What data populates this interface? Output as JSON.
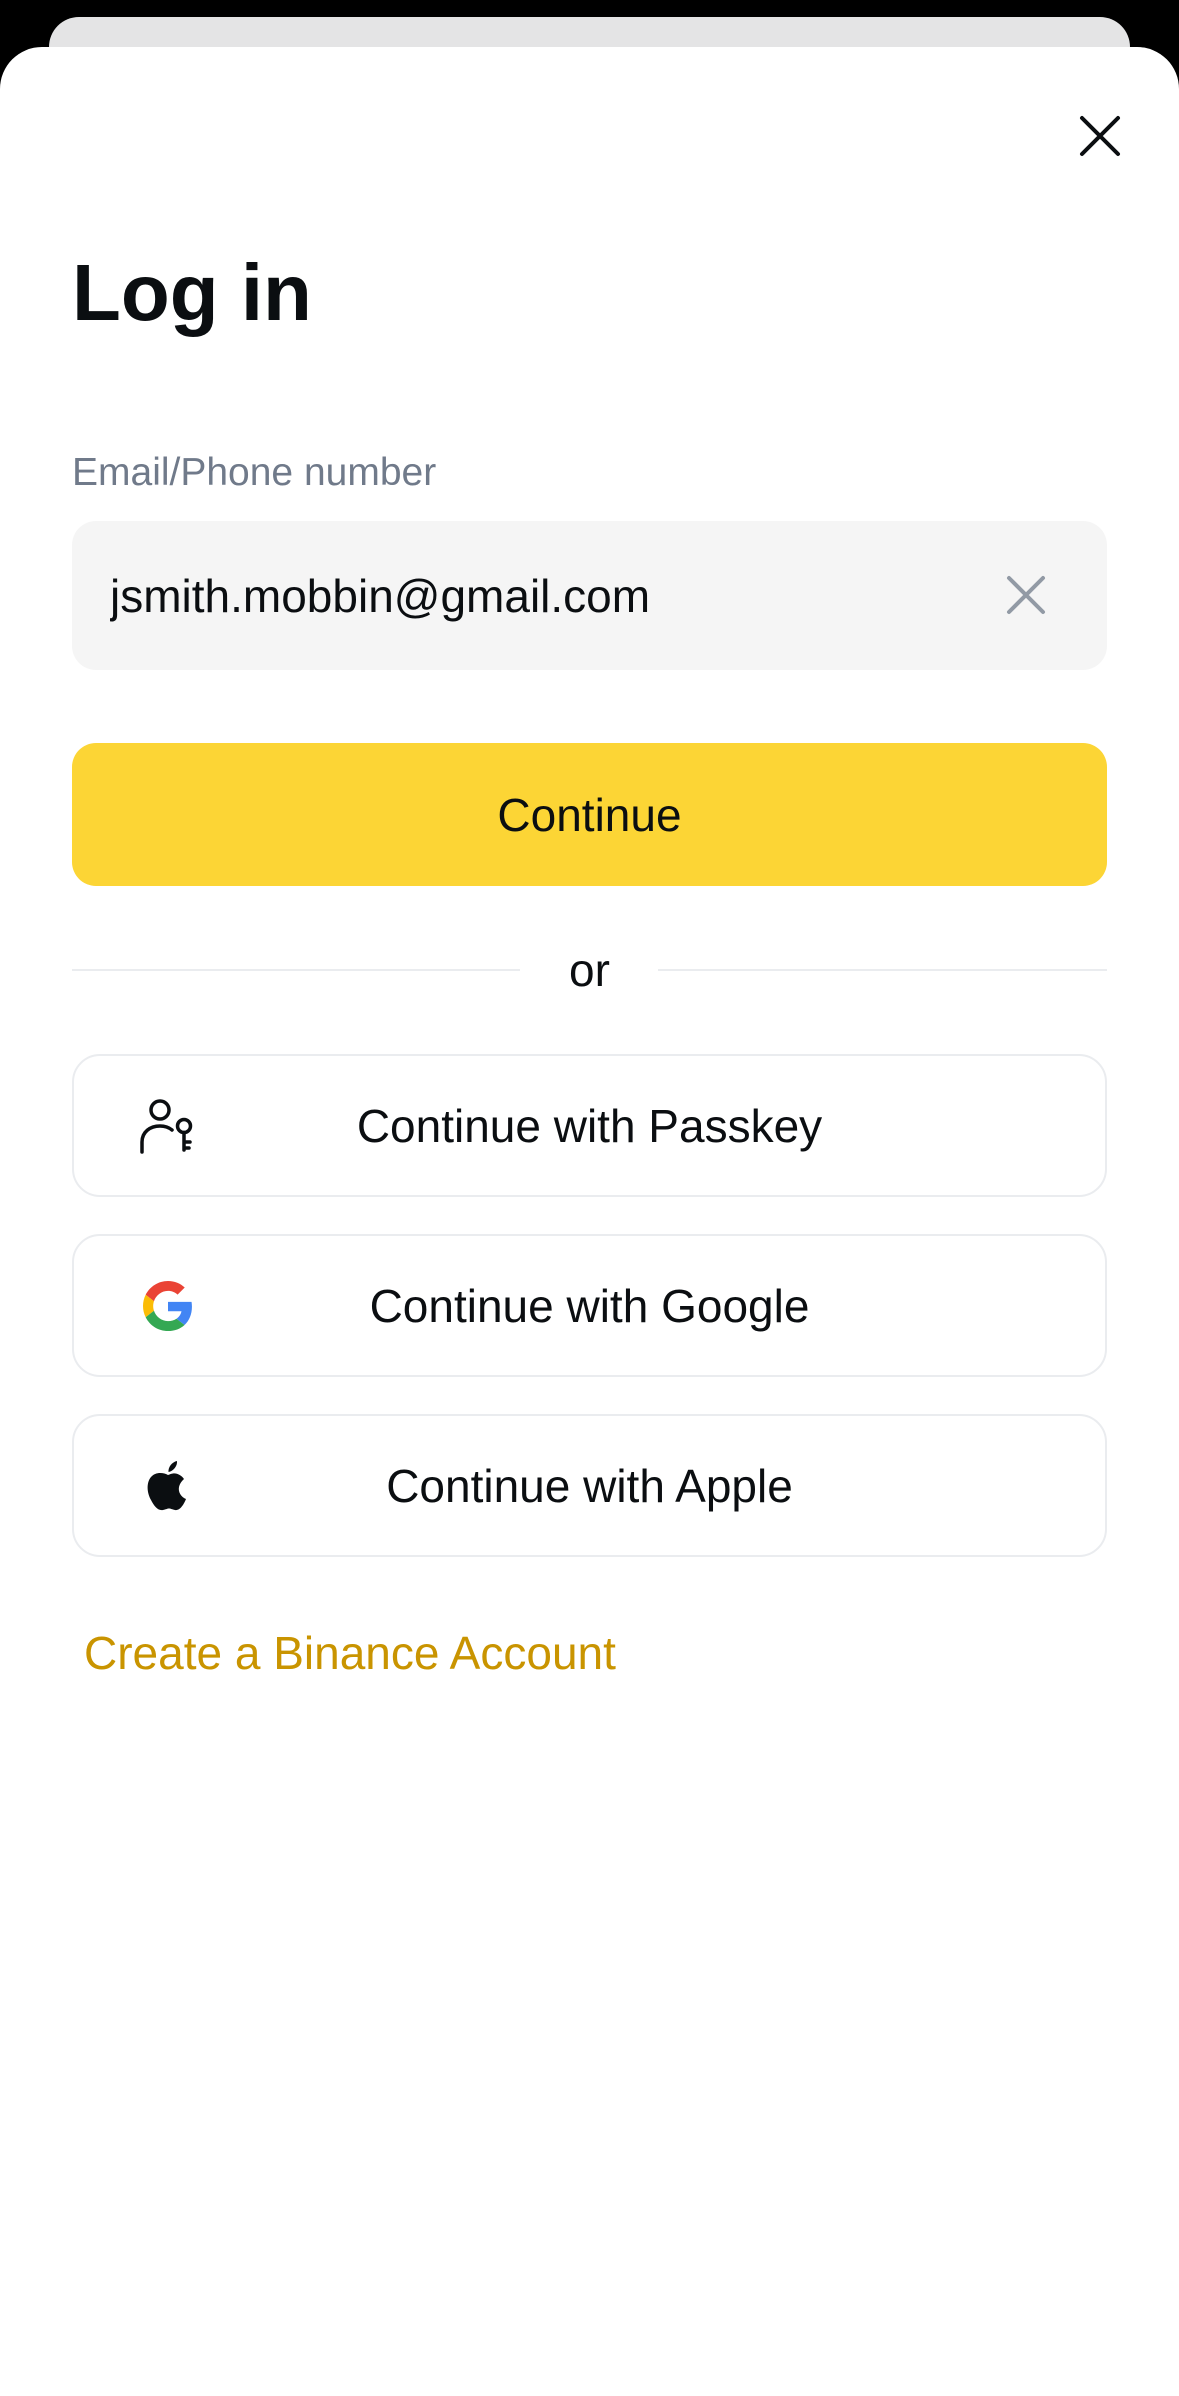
{
  "header": {
    "title": "Log in",
    "close_icon": "close-icon"
  },
  "form": {
    "email_label": "Email/Phone number",
    "email_value": "jsmith.mobbin@gmail.com",
    "clear_icon": "clear-icon",
    "continue_label": "Continue"
  },
  "divider": {
    "text": "or"
  },
  "social": [
    {
      "label": "Continue with Passkey",
      "icon": "passkey-icon"
    },
    {
      "label": "Continue with Google",
      "icon": "google-icon"
    },
    {
      "label": "Continue with Apple",
      "icon": "apple-icon"
    }
  ],
  "footer": {
    "create_account_label": "Create a Binance Account"
  },
  "colors": {
    "brand_yellow": "#FCD535",
    "link_gold": "#C99400",
    "label_gray": "#707A8A",
    "input_bg": "#F5F5F5"
  }
}
